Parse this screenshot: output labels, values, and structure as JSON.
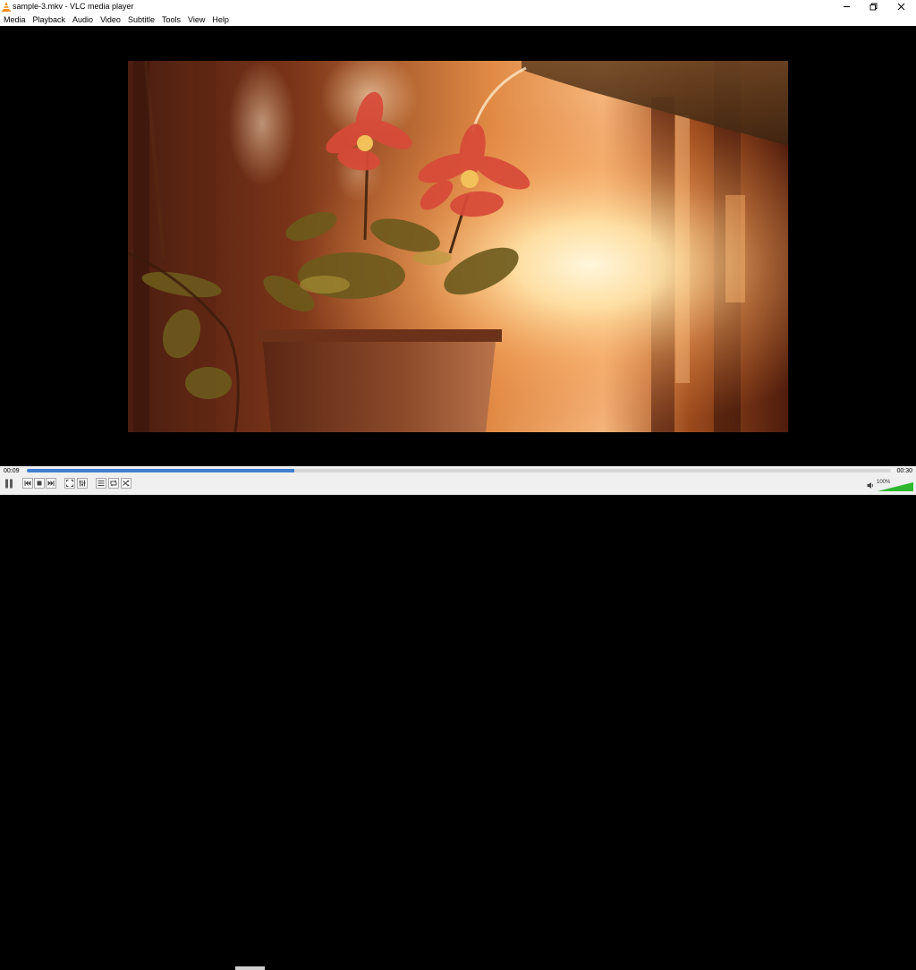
{
  "window": {
    "title": "sample-3.mkv - VLC media player",
    "icons": {
      "app": "vlc-cone-icon",
      "minimize": "minimize-icon",
      "maximize": "restore-icon",
      "close": "close-icon"
    }
  },
  "menu": [
    "Media",
    "Playback",
    "Audio",
    "Video",
    "Subtitle",
    "Tools",
    "View",
    "Help"
  ],
  "video": {
    "description_icon": "video-frame",
    "accent": "#f7a84a"
  },
  "playback": {
    "elapsed": "00:09",
    "total": "00:30",
    "progress": 0.31,
    "progress_color": "#3f7fd1"
  },
  "controls": {
    "buttons": [
      "pause-icon",
      "previous-icon",
      "stop-icon",
      "next-icon",
      "fullscreen-icon",
      "extended-settings-icon",
      "playlist-icon",
      "loop-icon",
      "shuffle-icon"
    ]
  },
  "volume": {
    "label": "100%",
    "level": 1.0,
    "color": "#2fb82f"
  }
}
